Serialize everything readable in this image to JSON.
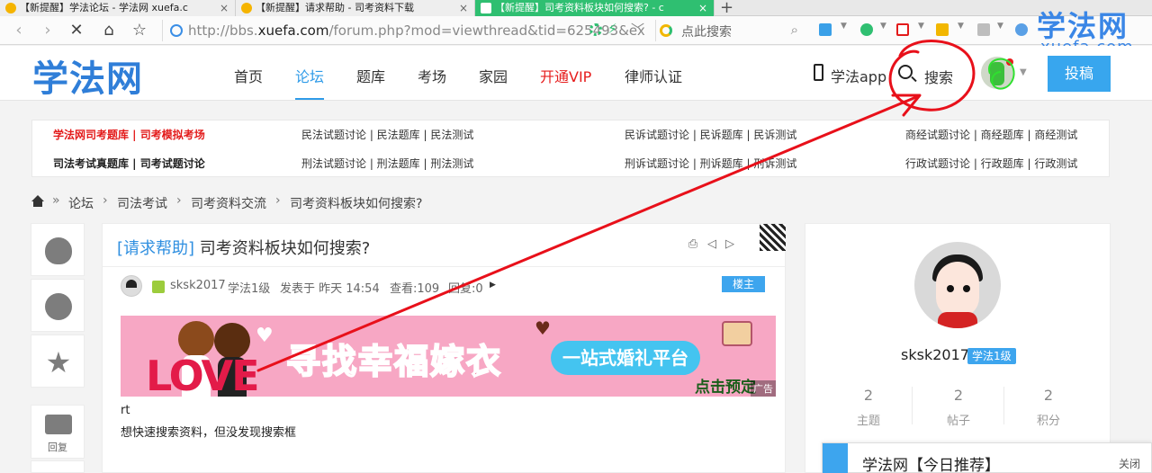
{
  "browser": {
    "tabs": [
      {
        "label": "【新提醒】学法论坛 - 学法网 xuefa.c",
        "active": false
      },
      {
        "label": "【新提醒】请求帮助 - 司考资料下载",
        "active": false
      },
      {
        "label": "【新提醒】司考资料板块如何搜索? - c",
        "active": true
      }
    ],
    "url_prefix": "http://bbs.",
    "url_domain": "xuefa.com",
    "url_rest": "/forum.php?mod=viewthread&tid=625493&ex",
    "search_placeholder": "点此搜索",
    "new_tab_icon": "plus-icon"
  },
  "watermark": {
    "brand": "学法网",
    "domain": "xuefa.com"
  },
  "site": {
    "logo": "学法网",
    "nav": [
      {
        "label": "首页"
      },
      {
        "label": "论坛",
        "active": true
      },
      {
        "label": "题库"
      },
      {
        "label": "考场"
      },
      {
        "label": "家园"
      },
      {
        "label": "开通VIP",
        "highlight": true
      },
      {
        "label": "律师认证"
      }
    ],
    "app_label": "学法app",
    "search_label": "搜索",
    "post_button": "投稿",
    "accent_color": "#2f9be8",
    "vip_color": "#e61d1d"
  },
  "links": {
    "row1": [
      "学法网司考题库 | 司考模拟考场",
      "民法试题讨论 | 民法题库 | 民法测试",
      "民诉试题讨论 | 民诉题库 | 民诉测试",
      "商经试题讨论 | 商经题库 | 商经测试"
    ],
    "row2": [
      "司法考试真题库 | 司考试题讨论",
      "刑法试题讨论 | 刑法题库 | 刑法测试",
      "刑诉试题讨论 | 刑诉题库 | 刑诉测试",
      "行政试题讨论 | 行政题库 | 行政测试"
    ]
  },
  "breadcrumb": [
    "论坛",
    "司法考试",
    "司考资料交流",
    "司考资料板块如何搜索?"
  ],
  "share": {
    "reply_label": "回复"
  },
  "post": {
    "tag": "[请求帮助]",
    "title": "司考资料板块如何搜索?",
    "author": "sksk2017",
    "level": "学法1级",
    "posted": "发表于 昨天 14:54",
    "views": "查看:109",
    "replies": "回复:0",
    "owner_badge": "楼主",
    "body_line1": "rt",
    "body_line2": "想快速搜索资料，但没发现搜索框",
    "ad": {
      "love_text": "LOVE",
      "slogan": "寻找幸福嫁衣",
      "pill": "一站式婚礼平台",
      "cta": "点击预定",
      "tag": "广告"
    }
  },
  "profile": {
    "name": "sksk2017",
    "level": "学法1级",
    "stats": [
      {
        "value": "2",
        "label": "主题"
      },
      {
        "value": "2",
        "label": "帖子"
      },
      {
        "value": "2",
        "label": "积分"
      }
    ]
  },
  "recommend": {
    "title": "学法网【今日推荐】",
    "close": "关闭"
  },
  "annotation": {
    "color": "#e8101a"
  }
}
